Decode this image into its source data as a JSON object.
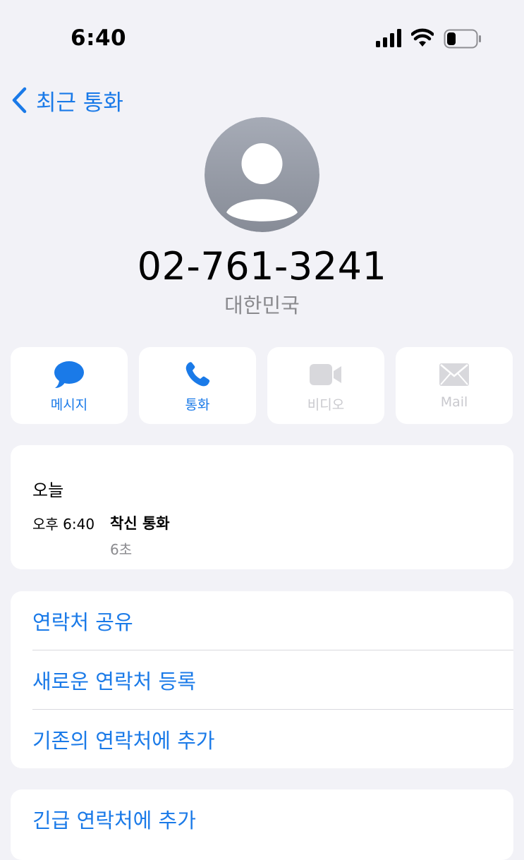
{
  "status_bar": {
    "time": "6:40",
    "signal_icon": "cellular-signal-icon",
    "wifi_icon": "wifi-icon",
    "battery_icon": "battery-icon",
    "battery_level": 0.3
  },
  "nav": {
    "back_label": "최근 통화",
    "back_icon": "chevron-left-icon"
  },
  "contact": {
    "avatar_icon": "person-silhouette-icon",
    "phone_number": "02-761-3241",
    "location": "대한민국"
  },
  "actions": [
    {
      "label": "메시지",
      "icon": "message-bubble-icon",
      "enabled": true
    },
    {
      "label": "통화",
      "icon": "phone-icon",
      "enabled": true
    },
    {
      "label": "비디오",
      "icon": "video-camera-icon",
      "enabled": false
    },
    {
      "label": "Mail",
      "icon": "envelope-icon",
      "enabled": false
    }
  ],
  "call_history": {
    "day": "오늘",
    "entries": [
      {
        "time": "오후 6:40",
        "type": "착신 통화",
        "duration": "6초"
      }
    ]
  },
  "contact_options": [
    {
      "label": "연락처 공유"
    },
    {
      "label": "새로운 연락처 등록"
    },
    {
      "label": "기존의 연락처에 추가"
    }
  ],
  "emergency": {
    "label": "긴급 연락처에 추가"
  },
  "colors": {
    "accent": "#1a7ae8",
    "background": "#f2f2f7",
    "disabled": "#c9c9ce",
    "secondary_text": "#8a8a8e"
  }
}
